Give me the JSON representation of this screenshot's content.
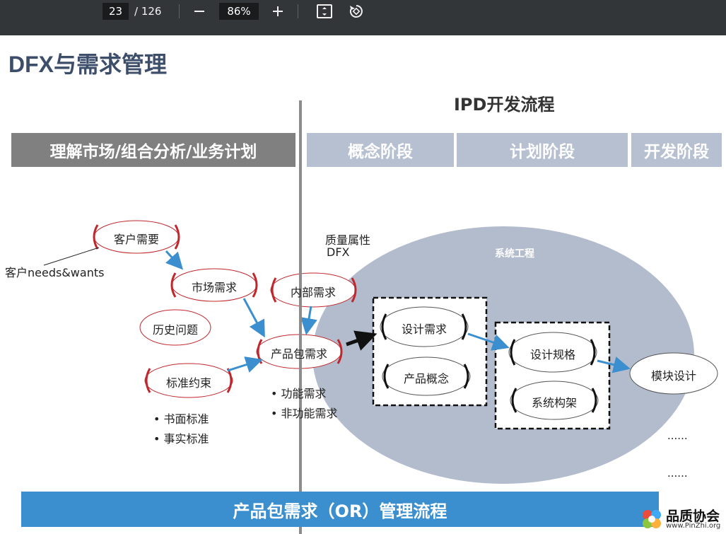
{
  "toolbar": {
    "current_page": "23",
    "total_pages": "/ 126",
    "zoom": "86%"
  },
  "slide": {
    "title": "DFX与需求管理",
    "ipd_title": "IPD开发流程",
    "bands": {
      "market": "理解市场/组合分析/业务计划",
      "concept": "概念阶段",
      "plan": "计划阶段",
      "develop": "开发阶段"
    },
    "nodes": {
      "customer_needs": "客户需要",
      "customer_needs_wants": "客户needs&wants",
      "market_req": "市场需求",
      "history": "历史问题",
      "standards": "标准约束",
      "internal_req": "内部需求",
      "product_pkg": "产品包需求",
      "quality_attr": "质量属性",
      "dfx": "DFX",
      "sys_eng": "系统工程",
      "design_req": "设计需求",
      "product_concept": "产品概念",
      "design_spec": "设计规格",
      "sys_arch": "系统构架",
      "module_design": "模块设计",
      "dots1": "......",
      "dots2": "......"
    },
    "bullets": {
      "written_std": "• 书面标准",
      "fact_std": "• 事实标准",
      "func_req": "• 功能需求",
      "nonfunc_req": "• 非功能需求"
    },
    "bottom_bar": "产品包需求（OR）管理流程",
    "logo": {
      "name": "品质协会",
      "url": "www.PinZhi.org"
    }
  },
  "colors": {
    "toolbar_bg": "#323639",
    "band_gray": "#808080",
    "band_blue": "#b6c0d0",
    "ellipse_fill": "#b3bccd",
    "bottom_bar": "#3b8fcf",
    "arrow_blue": "#3b8fcf",
    "oval_red": "#c0272d"
  }
}
